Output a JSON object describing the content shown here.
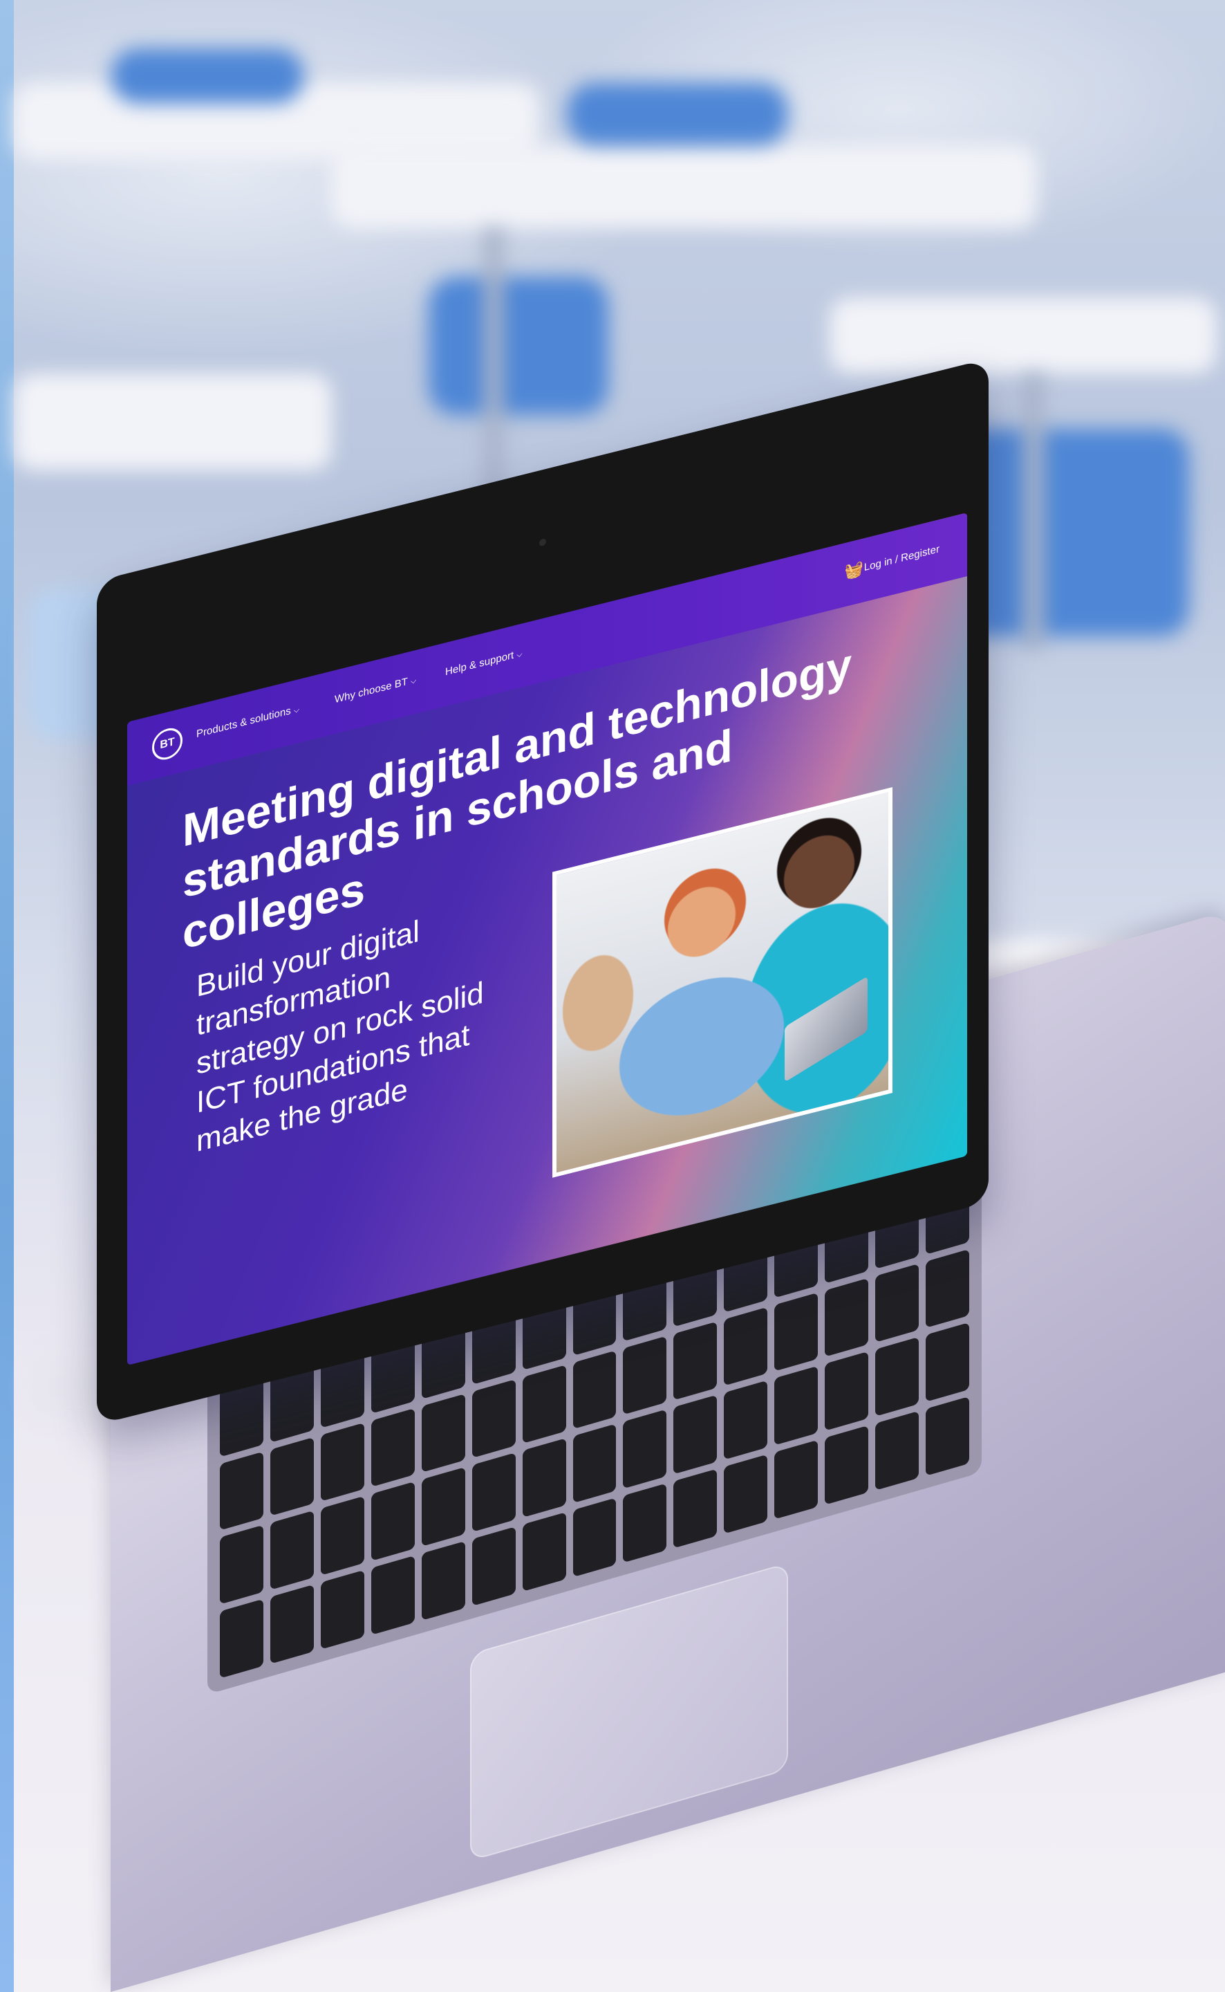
{
  "website": {
    "nav": {
      "logo": "BT",
      "items": [
        {
          "label": "Products & solutions"
        },
        {
          "label": "Why choose BT"
        },
        {
          "label": "Help & support"
        }
      ],
      "basket_icon": "basket-icon",
      "login_label": "Log in / Register"
    },
    "hero": {
      "title": "Meeting digital and technology standards in schools and colleges",
      "subtitle": "Build your digital transformation strategy on rock solid ICT foundations that make the grade"
    },
    "colors": {
      "nav": "#4a1fb6",
      "gradient_start": "#3a2a9e",
      "gradient_mid": "#c07aa8",
      "gradient_end": "#16c3d8"
    }
  }
}
